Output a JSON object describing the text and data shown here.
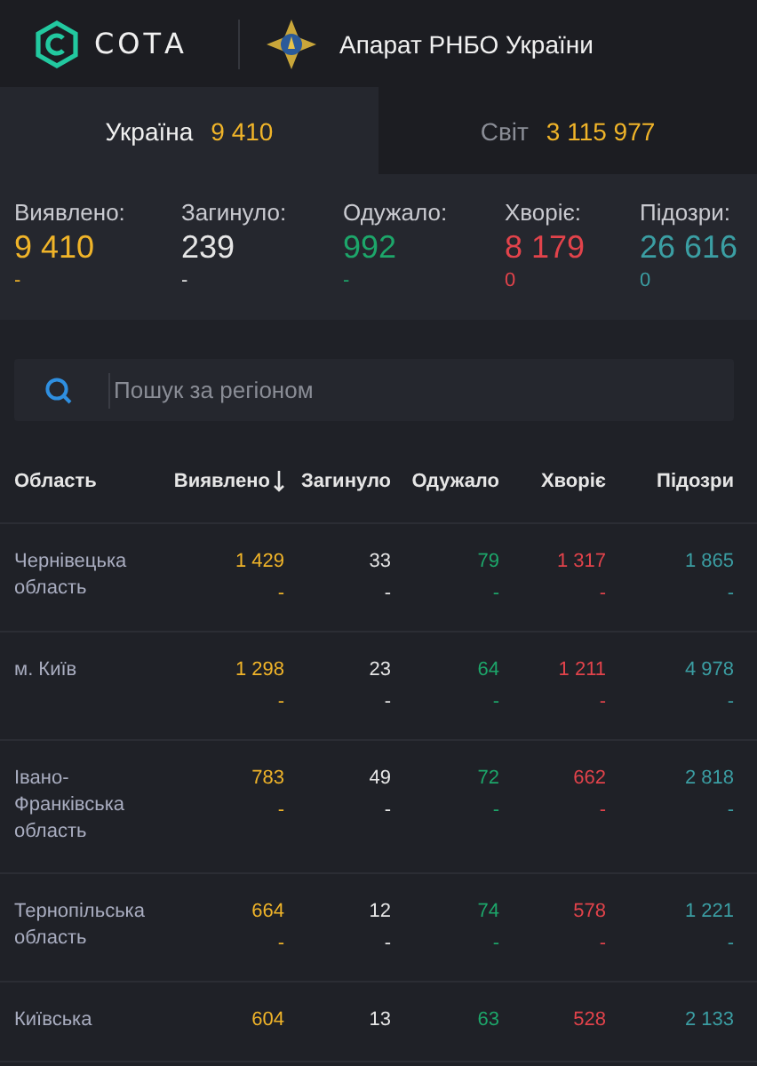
{
  "header": {
    "logo_text": "СОТА",
    "org_title": "Апарат РНБО України"
  },
  "tabs": [
    {
      "label": "Україна",
      "count": "9 410",
      "selected": true
    },
    {
      "label": "Світ",
      "count": "3 115 977",
      "selected": false
    }
  ],
  "stats": [
    {
      "label": "Виявлено:",
      "value": "9 410",
      "delta": "-",
      "color": "#f0b429"
    },
    {
      "label": "Загинуло:",
      "value": "239",
      "delta": "-",
      "color": "#e6e6e6"
    },
    {
      "label": "Одужало:",
      "value": "992",
      "delta": "-",
      "color": "#1da66a"
    },
    {
      "label": "Хворіє:",
      "value": "8 179",
      "delta": "0",
      "color": "#e2434b"
    },
    {
      "label": "Підозри:",
      "value": "26 616",
      "delta": "0",
      "color": "#3b9ea3"
    }
  ],
  "search": {
    "placeholder": "Пошук за регіоном"
  },
  "table": {
    "columns": [
      {
        "label": "Область",
        "sorted": false
      },
      {
        "label": "Виявлено",
        "sorted": true,
        "color": "#f0b429"
      },
      {
        "label": "Загинуло",
        "sorted": false,
        "color": "#e6e6e6"
      },
      {
        "label": "Одужало",
        "sorted": false,
        "color": "#1da66a"
      },
      {
        "label": "Хворіє",
        "sorted": false,
        "color": "#e2434b"
      },
      {
        "label": "Підозри",
        "sorted": false,
        "color": "#3b9ea3"
      }
    ],
    "rows": [
      {
        "cells": [
          {
            "value": "Чернівецька область"
          },
          {
            "value": "1 429",
            "delta": "-"
          },
          {
            "value": "33",
            "delta": "-"
          },
          {
            "value": "79",
            "delta": "-"
          },
          {
            "value": "1 317",
            "delta": "-"
          },
          {
            "value": "1 865",
            "delta": "-"
          }
        ]
      },
      {
        "cells": [
          {
            "value": "м. Київ"
          },
          {
            "value": "1 298",
            "delta": "-"
          },
          {
            "value": "23",
            "delta": "-"
          },
          {
            "value": "64",
            "delta": "-"
          },
          {
            "value": "1 211",
            "delta": "-"
          },
          {
            "value": "4 978",
            "delta": "-"
          }
        ]
      },
      {
        "cells": [
          {
            "value": "Івано-Франківська область"
          },
          {
            "value": "783",
            "delta": "-"
          },
          {
            "value": "49",
            "delta": "-"
          },
          {
            "value": "72",
            "delta": "-"
          },
          {
            "value": "662",
            "delta": "-"
          },
          {
            "value": "2 818",
            "delta": "-"
          }
        ]
      },
      {
        "cells": [
          {
            "value": "Тернопільська область"
          },
          {
            "value": "664",
            "delta": "-"
          },
          {
            "value": "12",
            "delta": "-"
          },
          {
            "value": "74",
            "delta": "-"
          },
          {
            "value": "578",
            "delta": "-"
          },
          {
            "value": "1 221",
            "delta": "-"
          }
        ]
      },
      {
        "cells": [
          {
            "value": "Київська"
          },
          {
            "value": "604"
          },
          {
            "value": "13"
          },
          {
            "value": "63"
          },
          {
            "value": "528"
          },
          {
            "value": "2 133"
          }
        ]
      }
    ]
  }
}
